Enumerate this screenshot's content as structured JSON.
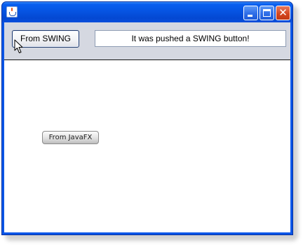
{
  "window": {
    "title": "",
    "title_icon": "java-cup-icon",
    "controls": {
      "minimize_icon": "minimize-icon",
      "maximize_icon": "maximize-icon",
      "close_icon": "close-icon",
      "close_glyph": "✕"
    },
    "colors": {
      "titlebar": "#0a5ff0",
      "close_button": "#d3451d",
      "panel_background": "#d5d8e1"
    }
  },
  "swing_panel": {
    "button_label": "From SWING",
    "status_text": "It was pushed a SWING button!"
  },
  "javafx_panel": {
    "button_label": "From JavaFX"
  },
  "cursor": {
    "icon": "mouse-pointer-icon"
  }
}
